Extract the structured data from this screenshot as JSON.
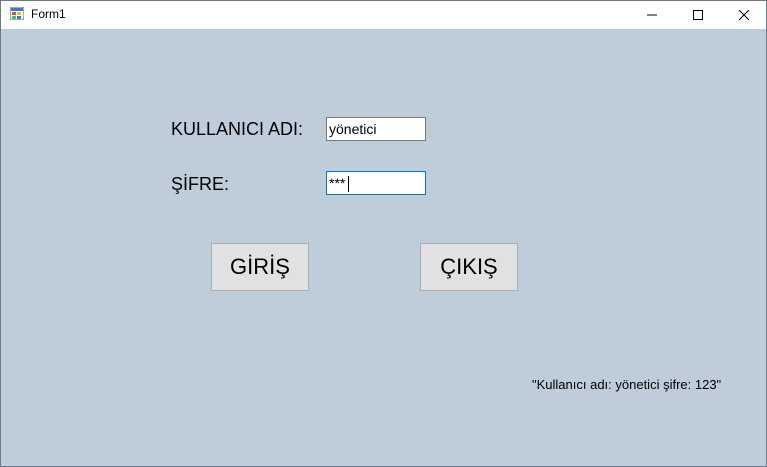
{
  "window": {
    "title": "Form1",
    "icon": "winforms-app-icon",
    "controls": [
      "minimize-icon",
      "maximize-icon",
      "close-icon"
    ]
  },
  "form": {
    "username_label": "KULLANICI ADI:",
    "username_value": "yönetici",
    "password_label": "ŞİFRE:",
    "password_value": "***",
    "login_button": "GİRİŞ",
    "exit_button": "ÇIKIŞ",
    "hint": "\"Kullanıcı adı: yönetici şifre: 123\""
  },
  "colors": {
    "client_background": "#bfccd9",
    "button_background": "#e1e1e1",
    "focus_border": "#0078d7"
  }
}
